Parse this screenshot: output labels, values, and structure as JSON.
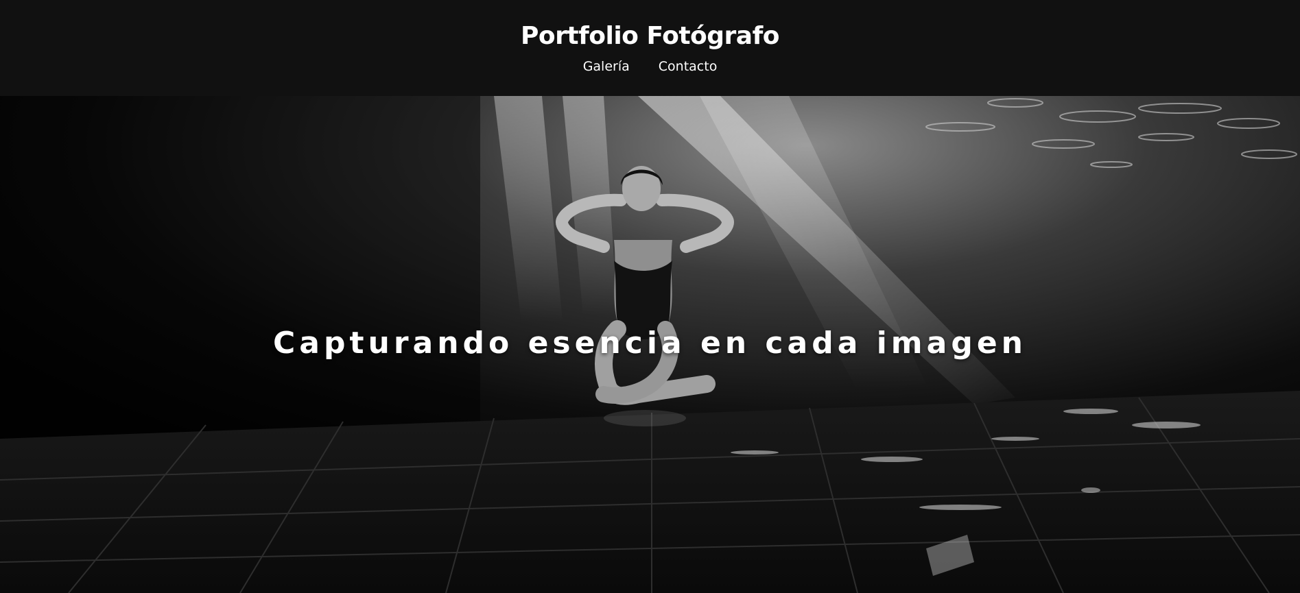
{
  "header": {
    "title": "Portfolio Fotógrafo",
    "nav": [
      {
        "label": "Galería"
      },
      {
        "label": "Contacto"
      }
    ]
  },
  "hero": {
    "headline": "Capturando esencia en cada imagen",
    "photo_subject": "woman-sitting-underwater-pool-light-rays"
  },
  "colors": {
    "header_bg": "#111111",
    "text": "#ffffff"
  }
}
